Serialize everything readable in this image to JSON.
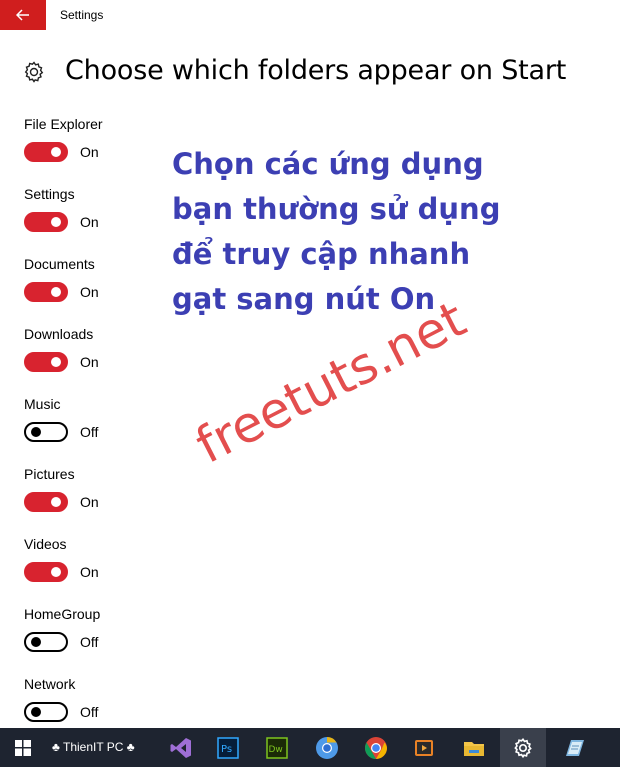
{
  "window": {
    "title": "Settings"
  },
  "page": {
    "title": "Choose which folders appear on Start"
  },
  "settings": [
    {
      "label": "File Explorer",
      "state": "On",
      "on": true
    },
    {
      "label": "Settings",
      "state": "On",
      "on": true
    },
    {
      "label": "Documents",
      "state": "On",
      "on": true
    },
    {
      "label": "Downloads",
      "state": "On",
      "on": true
    },
    {
      "label": "Music",
      "state": "Off",
      "on": false
    },
    {
      "label": "Pictures",
      "state": "On",
      "on": true
    },
    {
      "label": "Videos",
      "state": "On",
      "on": true
    },
    {
      "label": "HomeGroup",
      "state": "Off",
      "on": false
    },
    {
      "label": "Network",
      "state": "Off",
      "on": false
    }
  ],
  "annotation": {
    "lines": [
      "Chọn các ứng dụng",
      "bạn thường sử dụng",
      "để truy cập nhanh",
      "gạt sang nút On"
    ]
  },
  "watermark": "freetuts.net",
  "taskbar": {
    "pc_label": "♣ ThienIT PC ♣",
    "icons": [
      "windows-start-icon",
      "visual-studio-icon",
      "photoshop-icon",
      "dreamweaver-icon",
      "chrome-canary-icon",
      "chrome-icon",
      "media-player-icon",
      "file-explorer-icon",
      "settings-icon",
      "notepad-icon"
    ]
  },
  "colors": {
    "accent": "#d8232f",
    "annotation": "#3c3fb3",
    "taskbar": "#1e2430"
  }
}
